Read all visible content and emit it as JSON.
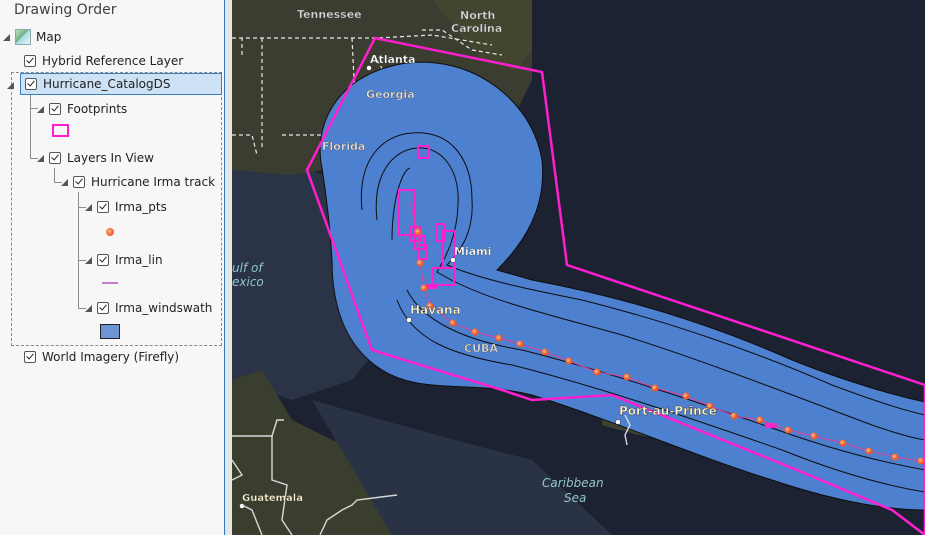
{
  "panel": {
    "title": "Drawing Order",
    "layers": {
      "map": "Map",
      "hybrid": "Hybrid Reference Layer",
      "catalog": "Hurricane_CatalogDS",
      "footprints": "Footprints",
      "layers_in_view": "Layers In View",
      "irma_track": "Hurricane Irma track",
      "irma_pts": "Irma_pts",
      "irma_lin": "Irma_lin",
      "irma_windswath": "Irma_windswath",
      "world_imagery": "World Imagery (Firefly)"
    },
    "checked": {
      "hybrid": true,
      "catalog": true,
      "footprints": true,
      "layers_in_view": true,
      "irma_track": true,
      "irma_pts": true,
      "irma_lin": true,
      "irma_windswath": true,
      "world_imagery": true
    },
    "selected_layer": "Hurricane_CatalogDS"
  },
  "symbols": {
    "footprint_outline": "#ff00cc",
    "point_fill": "#f26a2e",
    "line_color": "#c77ac7",
    "windswath_fill": "#6f94d4"
  },
  "map": {
    "labels": {
      "tennessee": "Tennessee",
      "north": "North",
      "carolina": "Carolina",
      "atlanta": "Atlanta",
      "georgia": "Georgia",
      "florida": "Florida",
      "gulf1": "ulf of",
      "gulf2": "exico",
      "miami": "Miami",
      "havana": "Havana",
      "cuba": "CUBA",
      "port_au_prince": "Port-au-Prince",
      "caribbean1": "Caribbean",
      "caribbean2": "Sea",
      "guatemala": "Guatemala"
    },
    "colors": {
      "swath": "#4e80d0",
      "footprint": "#ff1fcf",
      "track": "#e0409a",
      "point": "#f5672a",
      "ocean": "#1c2233",
      "land": "#3a3f32"
    }
  }
}
